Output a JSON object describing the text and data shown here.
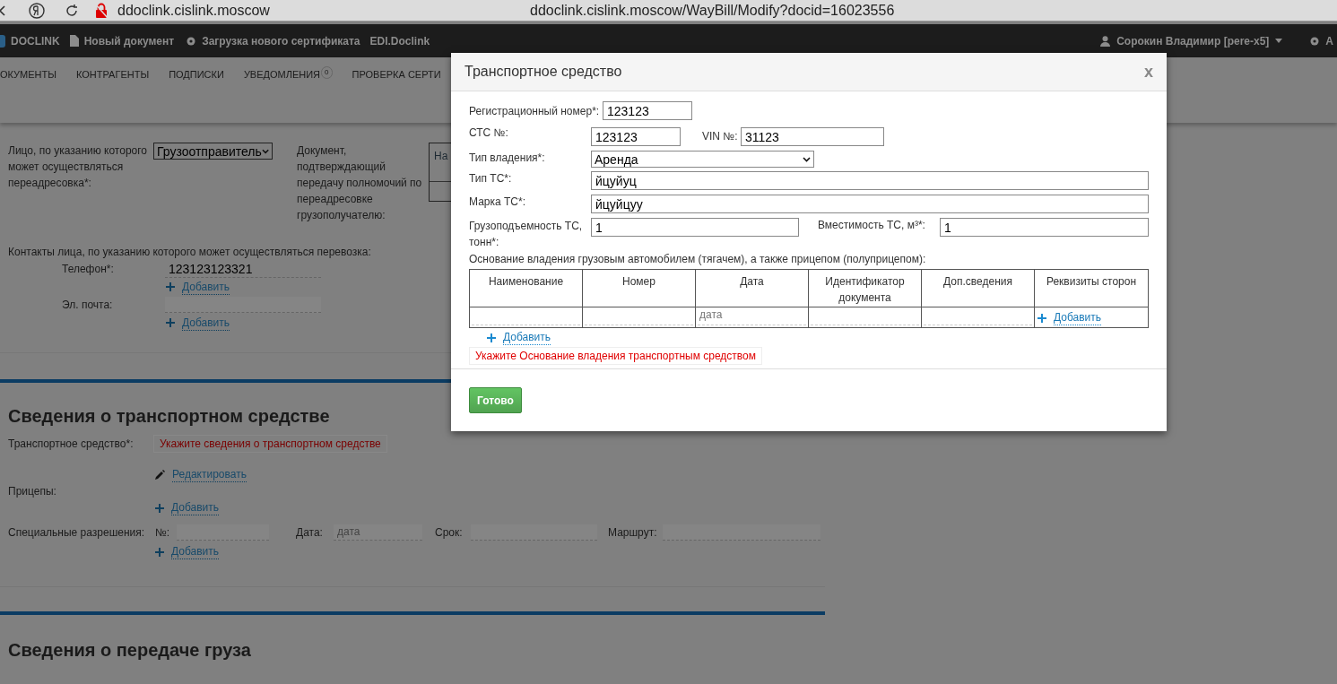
{
  "browser": {
    "site": "ddoclink.cislink.moscow",
    "url": "ddoclink.cislink.moscow/WayBill/Modify?docid=16023556"
  },
  "navbar": {
    "brand": "DOCLINK",
    "links": [
      "Новый документ",
      "Загрузка нового сертификата",
      "EDI.Doclink"
    ],
    "user": "Сорокин Владимир [pere-x5]",
    "settings": "А"
  },
  "menu": [
    {
      "label": "ОКУМЕНТЫ"
    },
    {
      "label": "КОНТРАГЕНТЫ"
    },
    {
      "label": "ПОДПИСКИ"
    },
    {
      "label": "УВЕДОМЛЕНИЯ",
      "badge": "0"
    },
    {
      "label": "ПРОВЕРКА СЕРТИ"
    }
  ],
  "redirect": {
    "label": "Лицо, по указанию которого может осуществляться переадресовка*:",
    "select": "Грузоотправитель",
    "doc_label": "Документ, подтверждающий передачу полномочий по переадресовке грузополучателю:",
    "table_cell": "На"
  },
  "contacts": {
    "title": "Контакты лица, по указанию которого может осуществляться перевозка:",
    "phone_label": "Телефон*:",
    "phone": "123123123321",
    "phone_add": "Добавить",
    "email_label": "Эл. почта:",
    "email_add": "Добавить"
  },
  "transport": {
    "title": "Сведения о транспортном средстве",
    "vehicle_label": "Транспортное средство*:",
    "vehicle_error": "Укажите сведения о транспортном средстве",
    "edit": "Редактировать",
    "trailers_label": "Прицепы:",
    "trailers_add": "Добавить",
    "permits_label": "Специальные разрешения:",
    "permit_fields": [
      {
        "label": "№:"
      },
      {
        "label": "Дата:",
        "placeholder": "дата"
      },
      {
        "label": "Срок:"
      },
      {
        "label": "Маршрут:"
      }
    ],
    "permits_add": "Добавить"
  },
  "cargo": {
    "title": "Сведения о передаче груза"
  },
  "modal": {
    "title": "Транспортное средство",
    "close": "x",
    "reg_label": "Регистрационный номер*:",
    "reg": "123123",
    "sts_label": "СТС №:",
    "sts": "123123",
    "vin_label": "VIN №:",
    "vin": "31123",
    "ownership_label": "Тип владения*:",
    "ownership": "Аренда",
    "type_label": "Тип ТС*:",
    "type": "йцуйуц",
    "brand_label": "Марка ТС*:",
    "brand": "йцуйцуу",
    "capacity_label": "Грузоподъемность ТС, тонн*:",
    "capacity": "1",
    "volume_label": "Вместимость ТС, м³*:",
    "volume": "1",
    "basis_title": "Основание владения грузовым автомобилем (тягачем), а также прицепом (полуприцепом):",
    "columns": [
      "Наименование",
      "Номер",
      "Дата",
      "Идентификатор документа",
      "Доп.сведения",
      "Реквизиты сторон"
    ],
    "row": [
      {
        "kind": "input"
      },
      {
        "kind": "input"
      },
      {
        "kind": "input",
        "placeholder": "дата"
      },
      {
        "kind": "input"
      },
      {
        "kind": "input"
      },
      {
        "kind": "add",
        "label": "Добавить"
      }
    ],
    "add": "Добавить",
    "error": "Укажите Основание владения транспортным средством",
    "done": "Готово"
  }
}
